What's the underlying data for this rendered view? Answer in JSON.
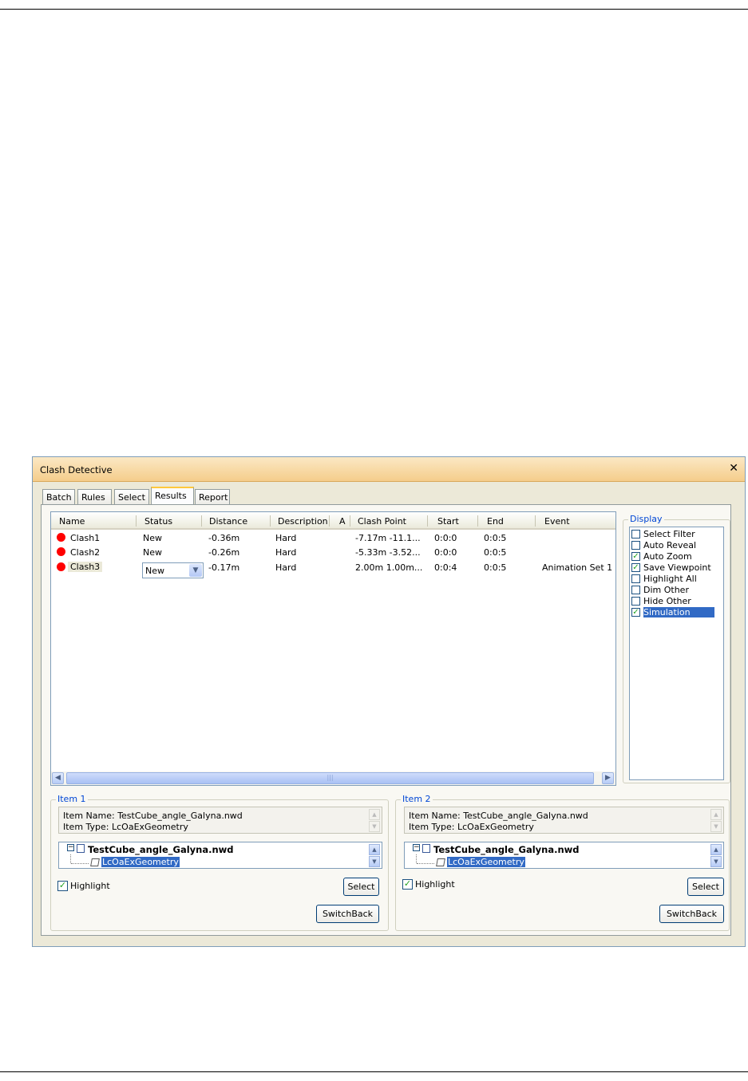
{
  "window": {
    "title": "Clash Detective",
    "close_glyph": "✕"
  },
  "tabs": [
    {
      "label": "Batch"
    },
    {
      "label": "Rules"
    },
    {
      "label": "Select"
    },
    {
      "label": "Results",
      "active": true
    },
    {
      "label": "Report"
    }
  ],
  "results": {
    "columns": [
      "Name",
      "Status",
      "Distance",
      "Description",
      "A",
      "Clash Point",
      "Start",
      "End",
      "Event"
    ],
    "rows": [
      {
        "name": "Clash1",
        "status": "New",
        "distance": "-0.36m",
        "description": "Hard",
        "a": "",
        "clash_point": "-7.17m  -11.1...",
        "start": "0:0:0",
        "end": "0:0:5",
        "event": ""
      },
      {
        "name": "Clash2",
        "status": "New",
        "distance": "-0.26m",
        "description": "Hard",
        "a": "",
        "clash_point": "-5.33m  -3.52...",
        "start": "0:0:0",
        "end": "0:0:5",
        "event": ""
      },
      {
        "name": "Clash3",
        "status": "New",
        "distance": "-0.17m",
        "description": "Hard",
        "a": "",
        "clash_point": "2.00m  1.00m...",
        "start": "0:0:4",
        "end": "0:0:5",
        "event": "Animation Set 1"
      }
    ],
    "status_dot_color": "#ff0000",
    "scroll_grip": "|||"
  },
  "display": {
    "legend": "Display",
    "options": [
      {
        "label": "Select Filter",
        "checked": false
      },
      {
        "label": "Auto Reveal",
        "checked": false
      },
      {
        "label": "Auto Zoom",
        "checked": true
      },
      {
        "label": "Save Viewpoint",
        "checked": true
      },
      {
        "label": "Highlight All",
        "checked": false
      },
      {
        "label": "Dim Other",
        "checked": false
      },
      {
        "label": "Hide Other",
        "checked": false
      },
      {
        "label": "Simulation",
        "checked": true,
        "selected": true
      }
    ]
  },
  "item1": {
    "legend": "Item 1",
    "item_name": "Item Name: TestCube_angle_Galyna.nwd",
    "item_type": "Item Type: LcOaExGeometry",
    "tree_root": "TestCube_angle_Galyna.nwd",
    "tree_child": "LcOaExGeometry",
    "highlight_label": "Highlight",
    "select_label": "Select",
    "switchback_label": "SwitchBack"
  },
  "item2": {
    "legend": "Item 2",
    "item_name": "Item Name: TestCube_angle_Galyna.nwd",
    "item_type": "Item Type: LcOaExGeometry",
    "tree_root": "TestCube_angle_Galyna.nwd",
    "tree_child": "LcOaExGeometry",
    "highlight_label": "Highlight",
    "select_label": "Select",
    "switchback_label": "SwitchBack"
  },
  "colors": {
    "accent": "#316ac5",
    "title_bar": "#f5cd8b",
    "legend": "#0046d5"
  }
}
